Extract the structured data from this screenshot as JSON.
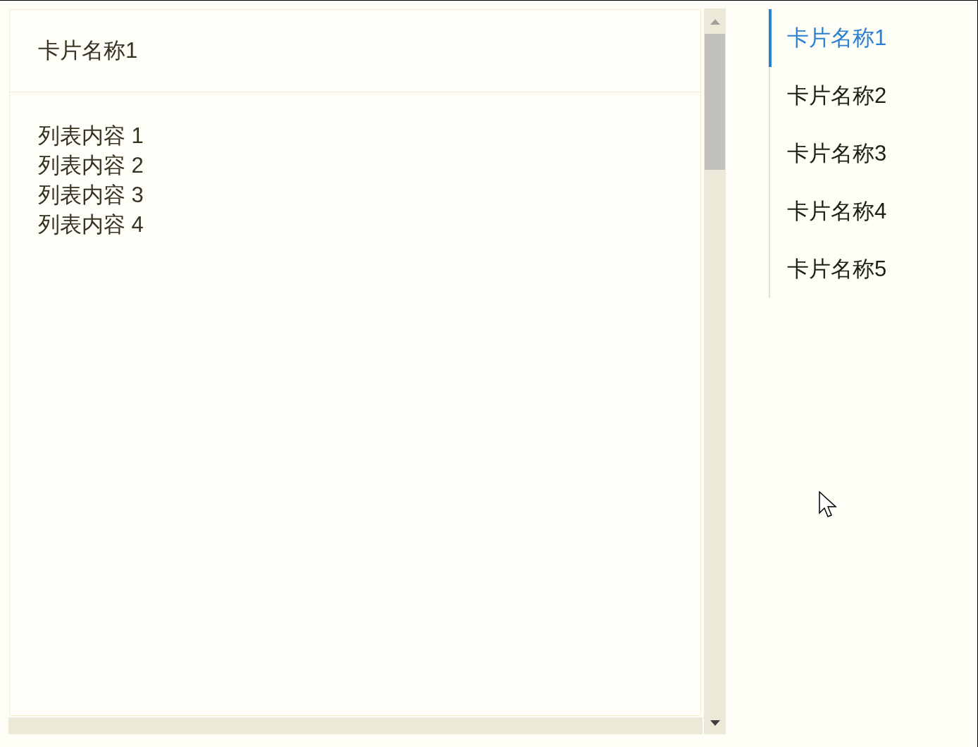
{
  "card": {
    "title": "卡片名称1",
    "items": [
      "列表内容 1",
      "列表内容 2",
      "列表内容 3",
      "列表内容 4"
    ]
  },
  "anchor_nav": {
    "items": [
      {
        "label": "卡片名称1",
        "selected": true
      },
      {
        "label": "卡片名称2",
        "selected": false
      },
      {
        "label": "卡片名称3",
        "selected": false
      },
      {
        "label": "卡片名称4",
        "selected": false
      },
      {
        "label": "卡片名称5",
        "selected": false
      }
    ]
  }
}
